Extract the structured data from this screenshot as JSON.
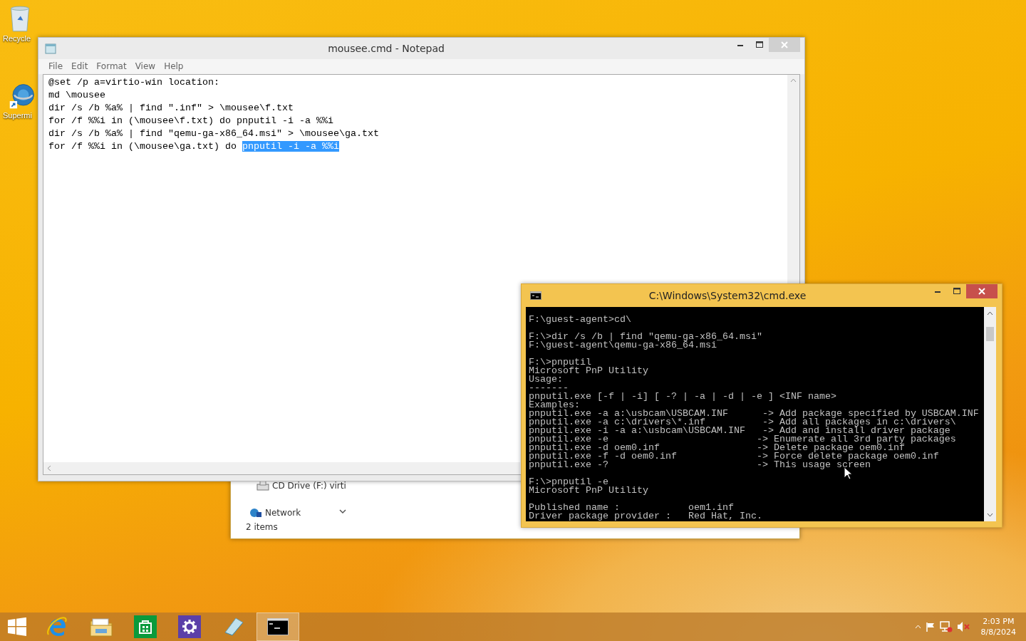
{
  "desktop": {
    "icons": [
      {
        "kind": "recycle-bin",
        "label": "Recycle"
      },
      {
        "kind": "shortcut",
        "label": "Supermi"
      }
    ]
  },
  "explorer_window": {
    "nav_items": [
      {
        "kind": "drive",
        "label": "CD Drive (F:) virti"
      },
      {
        "kind": "network",
        "label": "Network"
      }
    ],
    "status": "2 items"
  },
  "notepad": {
    "title": "mousee.cmd - Notepad",
    "active": false,
    "menu": [
      "File",
      "Edit",
      "Format",
      "View",
      "Help"
    ],
    "lines": [
      {
        "segments": [
          {
            "text": "@set /p a=virtio-win location:",
            "selected": false
          }
        ]
      },
      {
        "segments": [
          {
            "text": "md \\mousee",
            "selected": false
          }
        ]
      },
      {
        "segments": [
          {
            "text": "dir /s /b %a% | find \".inf\" > \\mousee\\f.txt",
            "selected": false
          }
        ]
      },
      {
        "segments": [
          {
            "text": "for /f %%i in (\\mousee\\f.txt) do pnputil -i -a %%i",
            "selected": false
          }
        ]
      },
      {
        "segments": [
          {
            "text": "dir /s /b %a% | find \"qemu-ga-x86_64.msi\" > \\mousee\\ga.txt",
            "selected": false
          }
        ]
      },
      {
        "segments": [
          {
            "text": "for /f %%i in (\\mousee\\ga.txt) do ",
            "selected": false
          },
          {
            "text": "pnputil -i -a %%i",
            "selected": true
          }
        ]
      }
    ]
  },
  "console": {
    "title": "C:\\Windows\\System32\\cmd.exe",
    "active": true,
    "blocks": [
      [
        "F:\\guest-agent>cd\\"
      ],
      [
        "F:\\>dir /s /b | find \"qemu-ga-x86_64.msi\"",
        "F:\\guest-agent\\qemu-ga-x86_64.msi"
      ],
      [
        "F:\\>pnputil",
        "Microsoft PnP Utility",
        "Usage:",
        "-------",
        "pnputil.exe [-f | -i] [ -? | -a | -d | -e ] <INF name>",
        "Examples:",
        "pnputil.exe -a a:\\usbcam\\USBCAM.INF      -> Add package specified by USBCAM.INF",
        "pnputil.exe -a c:\\drivers\\*.inf          -> Add all packages in c:\\drivers\\",
        "pnputil.exe -i -a a:\\usbcam\\USBCAM.INF   -> Add and install driver package",
        "pnputil.exe -e                          -> Enumerate all 3rd party packages",
        "pnputil.exe -d oem0.inf                 -> Delete package oem0.inf",
        "pnputil.exe -f -d oem0.inf              -> Force delete package oem0.inf",
        "pnputil.exe -?                          -> This usage screen"
      ],
      [
        "F:\\>pnputil -e",
        "Microsoft PnP Utility"
      ],
      [
        "Published name :            oem1.inf",
        "Driver package provider :   Red Hat, Inc."
      ]
    ]
  },
  "taskbar": {
    "apps": [
      {
        "kind": "ie",
        "selected": false
      },
      {
        "kind": "explorer",
        "selected": false
      },
      {
        "kind": "store",
        "selected": false
      },
      {
        "kind": "settings",
        "selected": false
      },
      {
        "kind": "notepad",
        "selected": false
      },
      {
        "kind": "cmd",
        "selected": true
      }
    ],
    "time": "2:03 PM",
    "date": "8/8/2024"
  }
}
